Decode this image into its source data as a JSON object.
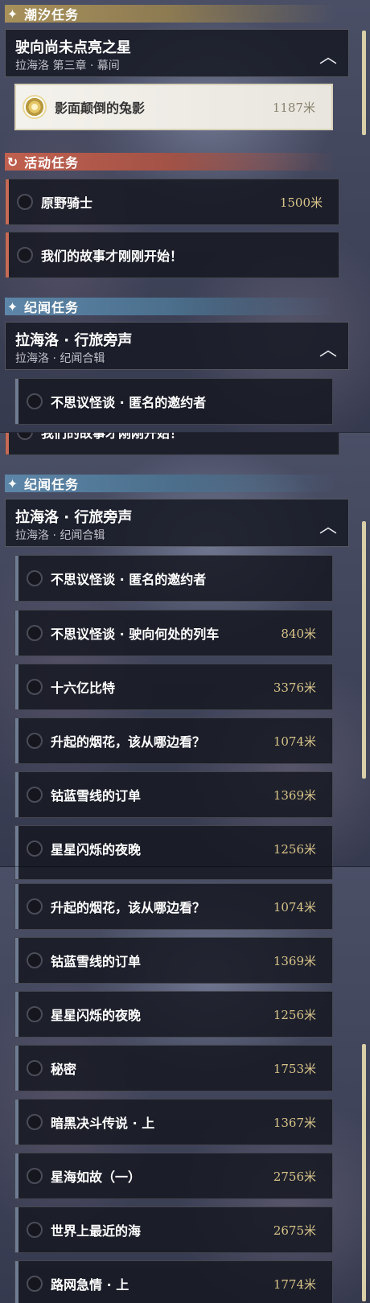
{
  "tide": {
    "header": "潮汐任务",
    "group_title": "驶向尚未点亮之星",
    "group_sub": "拉海洛 第三章 · 幕间",
    "active_name": "影面颠倒的兔影",
    "active_dist": "1187米"
  },
  "event": {
    "header": "活动任务",
    "items": [
      {
        "name": "原野骑士",
        "dist": "1500米"
      },
      {
        "name": "我们的故事才刚刚开始！",
        "dist": ""
      }
    ]
  },
  "tales": {
    "header": "纪闻任务",
    "group_title": "拉海洛 · 行旅旁声",
    "group_sub": "拉海洛 · 纪闻合辑"
  },
  "tale_items": [
    {
      "name": "不思议怪谈 · 匿名的邀约者",
      "dist": ""
    },
    {
      "name": "不思议怪谈 · 驶向何处的列车",
      "dist": "840米"
    },
    {
      "name": "十六亿比特",
      "dist": "3376米"
    },
    {
      "name": "升起的烟花，该从哪边看？",
      "dist": "1074米"
    },
    {
      "name": "钴蓝雪线的订单",
      "dist": "1369米"
    },
    {
      "name": "星星闪烁的夜晚",
      "dist": "1256米"
    },
    {
      "name": "秘密",
      "dist": "1753米"
    },
    {
      "name": "暗黑决斗传说 · 上",
      "dist": "1367米"
    },
    {
      "name": "星海如故（一）",
      "dist": "2756米"
    },
    {
      "name": "世界上最近的海",
      "dist": "2675米"
    },
    {
      "name": "路网急情 · 上",
      "dist": "1774米"
    }
  ],
  "icons": {
    "header_star": "sparkle-icon",
    "header_event": "refresh-icon",
    "chevron": "chevron-up-icon"
  }
}
